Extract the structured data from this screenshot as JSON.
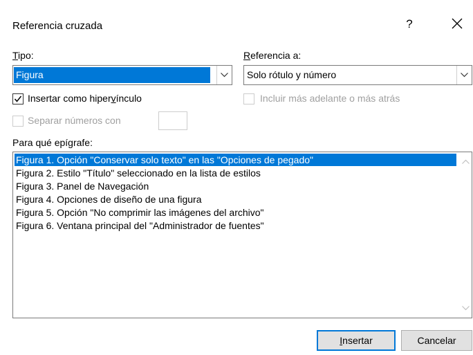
{
  "window": {
    "title": "Referencia cruzada",
    "help_label": "?",
    "close_icon": "close-icon"
  },
  "tipo": {
    "label_first": "T",
    "label_rest": "ipo:",
    "value": "Figura"
  },
  "referencia": {
    "label_first": "R",
    "label_rest": "eferencia a:",
    "value": "Solo rótulo y número"
  },
  "options": {
    "insert_link_pre": "Insertar como hiper",
    "insert_link_u": "v",
    "insert_link_post": "ínculo",
    "insert_link_checked": true,
    "include_above_below": "Incluir más adelante o más atrás",
    "separate_numbers": "Separar números con"
  },
  "captions": {
    "label": "Para qué epígrafe:",
    "items": [
      "Figura 1. Opción \"Conservar solo texto\" en las \"Opciones de pegado\"",
      "Figura 2. Estilo \"Título\" seleccionado en la lista de estilos",
      "Figura 3. Panel de Navegación",
      "Figura 4. Opciones de diseño de una figura",
      "Figura 5. Opción \"No comprimir las imágenes del archivo\"",
      "Figura 6. Ventana principal del \"Administrador de fuentes\""
    ],
    "selected_index": 0
  },
  "buttons": {
    "insert_first": "I",
    "insert_rest": "nsertar",
    "cancel": "Cancelar"
  },
  "colors": {
    "selection": "#0078d7",
    "disabled_text": "#a0a0a0",
    "button_face": "#e1e1e1"
  }
}
